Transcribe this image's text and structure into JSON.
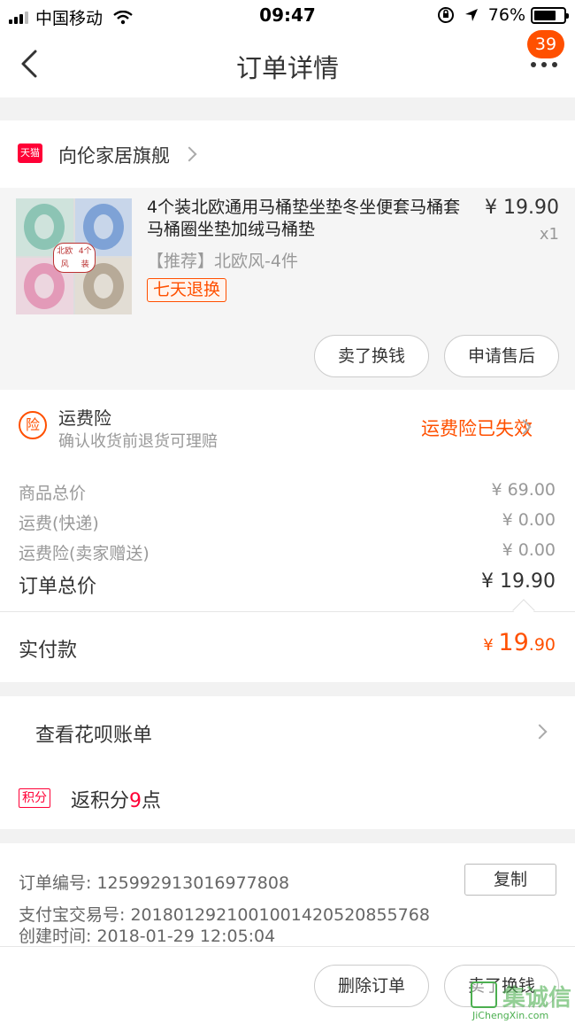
{
  "status_bar": {
    "carrier": "中国移动",
    "time": "09:47",
    "battery": "76%",
    "battery_level": 0.76
  },
  "nav": {
    "title": "订单详情",
    "badge": "39"
  },
  "shop": {
    "logo_text": "天猫",
    "name": "向伦家居旗舰"
  },
  "item": {
    "thumb_tag_line1": "北欧风",
    "thumb_tag_line2": "4个装",
    "title": "4个装北欧通用马桶垫坐垫冬坐便套马桶套马桶圈坐垫加绒马桶垫",
    "sku": "【推荐】北欧风-4件",
    "returns_tag": "七天退换",
    "price": "¥ 19.90",
    "qty": "x1",
    "btn_resell": "卖了换钱",
    "btn_aftersale": "申请售后"
  },
  "freight_insurance": {
    "icon_text": "险",
    "title": "运费险",
    "subtitle": "确认收货前退货可理赔",
    "status": "运费险已失效"
  },
  "price_rows": [
    {
      "label": "商品总价",
      "value": "¥ 69.00"
    },
    {
      "label": "运费(快递)",
      "value": "¥ 0.00"
    },
    {
      "label": "运费险(卖家赠送)",
      "value": "¥ 0.00"
    }
  ],
  "order_total": {
    "label": "订单总价",
    "value": "¥ 19.90"
  },
  "paid": {
    "label": "实付款",
    "symbol": "¥ ",
    "integer": "19",
    "decimal": ".90"
  },
  "huabei": {
    "label": "查看花呗账单"
  },
  "points": {
    "tag": "积分",
    "prefix": "返积分",
    "count": "9",
    "suffix": "点"
  },
  "order_info": {
    "order_no": "订单编号:   125992913016977808",
    "copy": "复制",
    "alipay_no": "支付宝交易号:   2018012921001001420520855768",
    "created": "创建时间:   2018-01-29 12:05:04"
  },
  "bottom": {
    "delete": "删除订单",
    "resell": "卖了换钱"
  },
  "watermark": {
    "text": "集诚信",
    "url": "JiChengXin.com"
  },
  "colors": {
    "accent": "#ff5000",
    "tmall_red": "#ff0036"
  }
}
